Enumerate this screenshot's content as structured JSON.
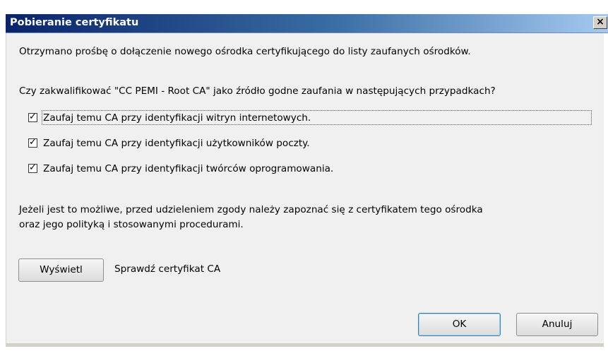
{
  "window": {
    "title": "Pobieranie certyfikatu",
    "close_glyph": "×"
  },
  "dialog": {
    "intro": "Otrzymano prośbę o dołączenie nowego ośrodka certyfikującego do listy zaufanych ośrodków.",
    "question": "Czy zakwalifikować \"CC PEMI - Root CA\" jako źródło godne zaufania w następujących przypadkach?",
    "options": [
      {
        "label": "Zaufaj temu CA przy identyfikacji witryn internetowych.",
        "checked": true
      },
      {
        "label": "Zaufaj temu CA przy identyfikacji użytkowników poczty.",
        "checked": true
      },
      {
        "label": "Zaufaj temu CA przy identyfikacji twórców oprogramowania.",
        "checked": true
      }
    ],
    "advice_line1": "Jeżeli jest to możliwe, przed udzieleniem zgody należy zapoznać się z certyfikatem tego ośrodka",
    "advice_line2": "oraz jego polityką i stosowanymi procedurami.",
    "view_button": "Wyświetl",
    "view_caption": "Sprawdź certyfikat CA",
    "ok_button": "OK",
    "cancel_button": "Anuluj"
  },
  "colors": {
    "titlebar_start": "#0a246a",
    "titlebar_end": "#a6caf0",
    "client_bg": "#f0f0f0"
  }
}
